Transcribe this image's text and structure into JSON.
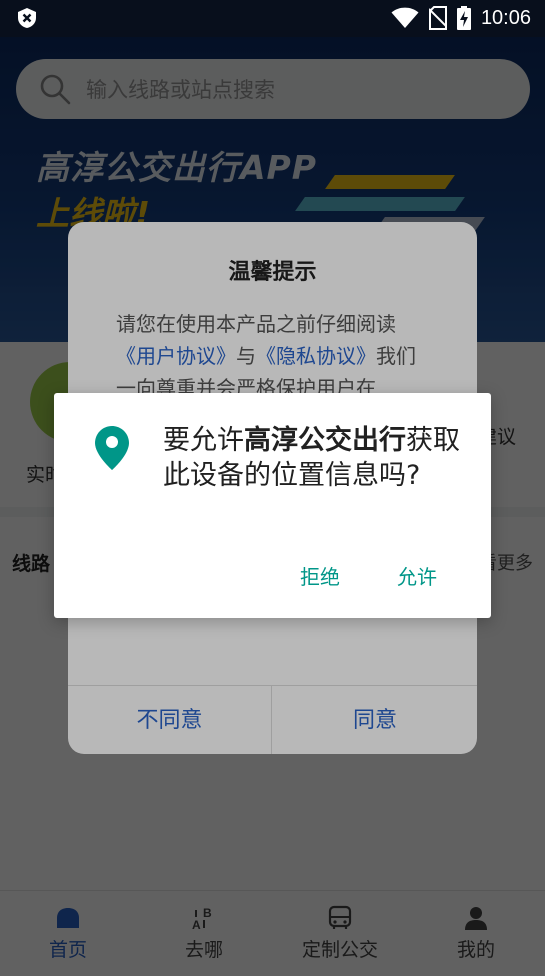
{
  "status_bar": {
    "time": "10:06",
    "icons": [
      "shield-x-icon",
      "wifi-icon",
      "no-sim-icon",
      "battery-charging-icon"
    ]
  },
  "search": {
    "placeholder": "输入线路或站点搜索"
  },
  "banner": {
    "title": "高淳公交出行APP",
    "subtitle": "上线啦!"
  },
  "quick_entries": [
    {
      "label": "实时"
    },
    {
      "label": "建议"
    }
  ],
  "section": {
    "title": "线路",
    "more": "看更多"
  },
  "tabs": [
    {
      "label": "首页",
      "icon": "home-icon",
      "active": true
    },
    {
      "label": "去哪",
      "icon": "route-ab-icon",
      "active": false
    },
    {
      "label": "定制公交",
      "icon": "bus-icon",
      "active": false
    },
    {
      "label": "我的",
      "icon": "user-icon",
      "active": false
    }
  ],
  "privacy_dialog": {
    "title": "温馨提示",
    "body_intro": "请您在使用本产品之前仔细阅读",
    "link_user_agreement": "《用户协议》",
    "body_and": "与",
    "link_privacy": "《隐私协议》",
    "body_rest": "我们一向尊重并会严格保护用户在",
    "disagree": "不同意",
    "agree": "同意"
  },
  "permission_dialog": {
    "prefix": "要允许",
    "app_name": "高淳公交出行",
    "suffix": "获取此设备的位置信息吗?",
    "deny": "拒绝",
    "allow": "允许",
    "icon": "location-pin-icon"
  },
  "colors": {
    "accent": "#009688",
    "brand_blue": "#2a63c8",
    "banner_yellow": "#f5c518"
  }
}
